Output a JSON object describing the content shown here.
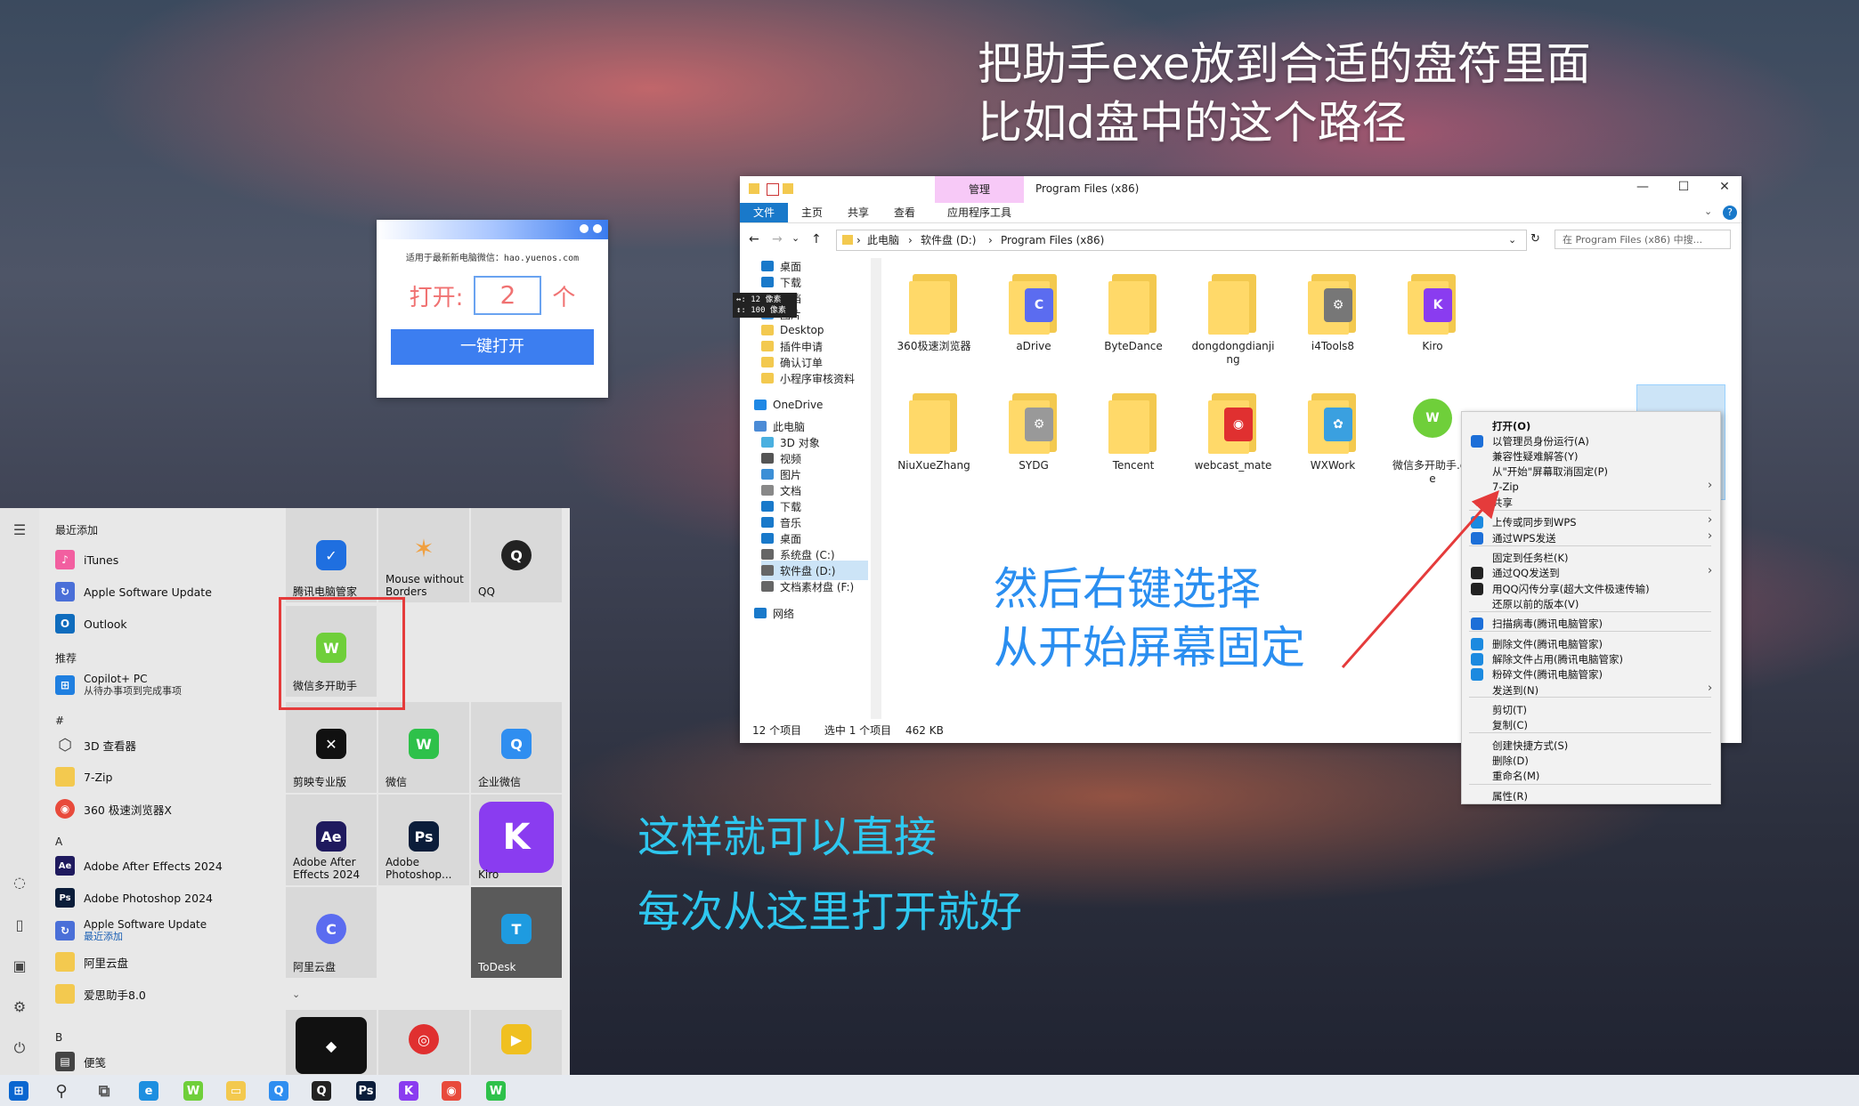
{
  "annotations": {
    "top_line1": "把助手exe放到合适的盘符里面",
    "top_line2": "比如d盘中的这个路径",
    "mid_line1": "然后右键选择",
    "mid_line2": "从开始屏幕固定",
    "bottom_line1": "这样就可以直接",
    "bottom_line2": "每次从这里打开就好"
  },
  "helper": {
    "notice": "适用于最新新电脑微信：hao.yuenos.com",
    "open_label": "打开:",
    "count_value": "2",
    "unit_label": "个",
    "button_label": "一键打开"
  },
  "start_menu": {
    "recent_heading": "最近添加",
    "recommended_heading": "推荐",
    "hash_heading": "#",
    "a_heading": "A",
    "b_heading": "B",
    "items": [
      {
        "label": "iTunes",
        "color": "#f25fa0"
      },
      {
        "label": "Apple Software Update",
        "color": "#4a6fd8"
      },
      {
        "label": "Outlook",
        "color": "#0f6cbd"
      },
      {
        "label": "Copilot+ PC",
        "sub": "从待办事项到完成事项",
        "color": "#1f7fe0"
      },
      {
        "label": "3D 查看器",
        "color": "#444444"
      },
      {
        "label": "7-Zip",
        "color": "#f3c94f"
      },
      {
        "label": "360 极速浏览器X",
        "color": "#e84a3b"
      },
      {
        "label": "Adobe After Effects 2024",
        "color": "#1f1a5e"
      },
      {
        "label": "Adobe Photoshop 2024",
        "color": "#0b1d3a"
      },
      {
        "label": "Apple Software Update",
        "sub": "最近添加",
        "color": "#4a6fd8"
      },
      {
        "label": "阿里云盘",
        "color": "#f3c94f"
      },
      {
        "label": "爱思助手8.0",
        "color": "#f3c94f"
      },
      {
        "label": "便笺",
        "color": "#444444"
      }
    ],
    "tiles": [
      {
        "label": "腾讯电脑管家",
        "glyph": "✓",
        "color": "#1f6fe0"
      },
      {
        "label": "Mouse without Borders",
        "glyph": "✶",
        "color": "#f0a040"
      },
      {
        "label": "QQ",
        "glyph": "Q",
        "color": "#222222"
      },
      {
        "label": "微信多开助手",
        "glyph": "W",
        "color": "#6fcf3a"
      },
      {
        "label": "剪映专业版",
        "glyph": "✕",
        "color": "#111111"
      },
      {
        "label": "微信",
        "glyph": "W",
        "color": "#2ec14a"
      },
      {
        "label": "企业微信",
        "glyph": "Q",
        "color": "#2f8ef0"
      },
      {
        "label": "Adobe After Effects 2024",
        "glyph": "Ae",
        "color": "#1f1a5e"
      },
      {
        "label": "Adobe Photoshop...",
        "glyph": "Ps",
        "color": "#0b1d3a"
      },
      {
        "label": "Kiro",
        "glyph": "K",
        "color": "#8a3cf0"
      },
      {
        "label": "阿里云盘",
        "glyph": "C",
        "color": "#5b6cf0"
      },
      {
        "label": "ToDesk",
        "glyph": "T",
        "color": "#1e9be0"
      }
    ]
  },
  "explorer": {
    "manage_tab": "管理",
    "title": "Program Files (x86)",
    "ribbon_tabs": [
      "文件",
      "主页",
      "共享",
      "查看",
      "应用程序工具"
    ],
    "breadcrumb": [
      "此电脑",
      "软件盘 (D:)",
      "Program Files (x86)"
    ],
    "search_placeholder": "在 Program Files (x86) 中搜...",
    "tooltip_line1": "↔: 12 像素",
    "tooltip_line2": "↕: 100 像素",
    "nav": [
      "桌面",
      "下载",
      "文档",
      "图片",
      "Desktop",
      "插件申请",
      "确认订单",
      "小程序审核资料",
      "OneDrive",
      "此电脑",
      "3D 对象",
      "视频",
      "图片",
      "文档",
      "下载",
      "音乐",
      "桌面",
      "系统盘 (C:)",
      "软件盘 (D:)",
      "文档素材盘 (F:)",
      "网络"
    ],
    "files": [
      {
        "name": "360极速浏览器",
        "badge": "",
        "color": ""
      },
      {
        "name": "aDrive",
        "badge": "C",
        "color": "#5b6cf0"
      },
      {
        "name": "ByteDance",
        "badge": "",
        "color": ""
      },
      {
        "name": "dongdongdianjing",
        "badge": "",
        "color": ""
      },
      {
        "name": "i4Tools8",
        "badge": "⚙",
        "color": "#777777"
      },
      {
        "name": "Kiro",
        "badge": "K",
        "color": "#8a3cf0"
      },
      {
        "name": "NiuXueZhang",
        "badge": "",
        "color": ""
      },
      {
        "name": "SYDG",
        "badge": "⚙",
        "color": "#999999"
      },
      {
        "name": "Tencent",
        "badge": "",
        "color": ""
      },
      {
        "name": "webcast_mate",
        "badge": "◉",
        "color": "#e03030"
      },
      {
        "name": "WXWork",
        "badge": "✿",
        "color": "#3aa0e0"
      },
      {
        "name": "微信多开助手.exe",
        "badge": "W",
        "color": "#6fcf3a"
      }
    ],
    "status_count": "12 个项目",
    "status_selected": "选中 1 个项目",
    "status_size": "462 KB"
  },
  "context_menu": {
    "items": [
      "打开(O)",
      "以管理员身份运行(A)",
      "兼容性疑难解答(Y)",
      "从\"开始\"屏幕取消固定(P)",
      "7-Zip",
      "共享",
      "上传或同步到WPS",
      "通过WPS发送",
      "固定到任务栏(K)",
      "通过QQ发送到",
      "用QQ闪传分享(超大文件极速传输)",
      "还原以前的版本(V)",
      "扫描病毒(腾讯电脑管家)",
      "删除文件(腾讯电脑管家)",
      "解除文件占用(腾讯电脑管家)",
      "粉碎文件(腾讯电脑管家)",
      "发送到(N)",
      "剪切(T)",
      "复制(C)",
      "创建快捷方式(S)",
      "删除(D)",
      "重命名(M)",
      "属性(R)"
    ]
  },
  "taskbar": {
    "icons": [
      {
        "name": "windows-start-icon",
        "color": "#0a66d0",
        "glyph": "⊞"
      },
      {
        "name": "search-icon",
        "color": "#333333",
        "glyph": "⚲"
      },
      {
        "name": "task-view-icon",
        "color": "#555555",
        "glyph": "⧉"
      },
      {
        "name": "edge-icon",
        "color": "#1d8fe0",
        "glyph": "e"
      },
      {
        "name": "wechat-helper-icon",
        "color": "#6fcf3a",
        "glyph": "W"
      },
      {
        "name": "file-explorer-icon",
        "color": "#f3c94f",
        "glyph": "▭"
      },
      {
        "name": "enterprise-wechat-icon",
        "color": "#2f8ef0",
        "glyph": "Q"
      },
      {
        "name": "qq-icon",
        "color": "#222222",
        "glyph": "Q"
      },
      {
        "name": "photoshop-icon",
        "color": "#0b1d3a",
        "glyph": "Ps"
      },
      {
        "name": "kiro-icon",
        "color": "#8a3cf0",
        "glyph": "K"
      },
      {
        "name": "browser-360-icon",
        "color": "#e84a3b",
        "glyph": "◉"
      },
      {
        "name": "wechat-icon",
        "color": "#2ec14a",
        "glyph": "W"
      }
    ]
  }
}
